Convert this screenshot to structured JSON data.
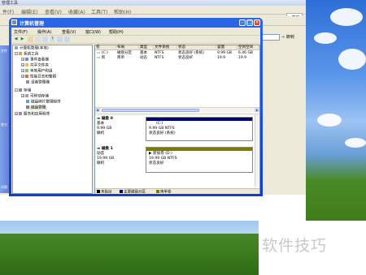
{
  "bg_window": {
    "title": "管理工具",
    "menu": [
      "件(F)",
      "编辑(E)",
      "查看(V)",
      "收藏(A)",
      "工具(T)",
      "帮助(H)"
    ],
    "go_label": "转到",
    "side_labels": [
      "文件",
      "其它",
      "详细"
    ]
  },
  "window": {
    "title": "计算机管理",
    "menu": [
      "文件(F)",
      "操作(A)",
      "查看(V)",
      "窗口(W)",
      "帮助(H)"
    ]
  },
  "tree": [
    {
      "label": "计算机管理(本地)",
      "level": 0,
      "expander": ""
    },
    {
      "label": "系统工具",
      "level": 1,
      "expander": "-"
    },
    {
      "label": "事件查看器",
      "level": 2,
      "expander": "+"
    },
    {
      "label": "共享文件夹",
      "level": 2,
      "expander": "+"
    },
    {
      "label": "本地用户和组",
      "level": 2,
      "expander": "+"
    },
    {
      "label": "性能日志和警报",
      "level": 2,
      "expander": "+"
    },
    {
      "label": "设备管理器",
      "level": 2,
      "expander": ""
    },
    {
      "label": "存储",
      "level": 1,
      "expander": "-"
    },
    {
      "label": "可移动存储",
      "level": 2,
      "expander": "+"
    },
    {
      "label": "磁盘碎片整理程序",
      "level": 2,
      "expander": ""
    },
    {
      "label": "磁盘管理",
      "level": 2,
      "expander": ""
    },
    {
      "label": "服务和应用程序",
      "level": 1,
      "expander": "+"
    }
  ],
  "volume_list": {
    "headers": [
      "卷",
      "布局",
      "类型",
      "文件系统",
      "状态",
      "容量",
      "空闲空间"
    ],
    "rows": [
      [
        "(C:)",
        "磁盘分区",
        "基本",
        "NTFS",
        "状态良好 (系统)",
        "9.99 GB",
        "6.46 GB"
      ],
      [
        "新",
        "简单",
        "动态",
        "NTFS",
        "状态良好",
        "19.9",
        "19.9"
      ]
    ]
  },
  "disks": [
    {
      "name": "磁盘 0",
      "type": "基本",
      "size": "9.99 GB",
      "status": "联机",
      "partition": {
        "name": "(C:)",
        "size": "9.99 GB NTFS",
        "status": "状态良好 (系统)"
      }
    },
    {
      "name": "磁盘 1",
      "type": "动态",
      "size": "19.99 GB",
      "status": "联机",
      "partition": {
        "name": "新加卷 (D:)",
        "size": "19.99 GB NTFS",
        "status": "状态良好"
      }
    }
  ],
  "legend": [
    "未指派",
    "主要磁盘分区",
    "简单卷"
  ],
  "watermark": "软件技巧",
  "colors": {
    "title_blue": "#0e3fd0",
    "primary_partition": "#00007b",
    "simple_volume": "#7b7b00",
    "unallocated": "#000000"
  }
}
